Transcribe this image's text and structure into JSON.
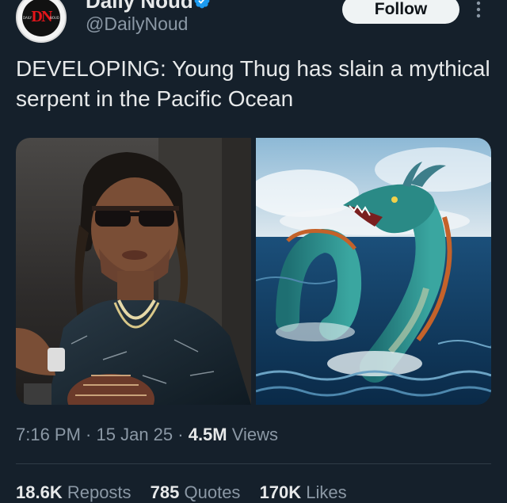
{
  "author": {
    "display_name": "Daily Noud",
    "handle": "@DailyNoud",
    "avatar_letters": "DN",
    "avatar_left_text": "DAILY",
    "avatar_right_text": "NOUD",
    "verified_icon": "verified-badge-icon"
  },
  "follow_label": "Follow",
  "more_icon": "more-vertical-icon",
  "tweet_text": "DEVELOPING: Young Thug has slain a mythical serpent in the Pacific Ocean",
  "media": [
    {
      "icon": "photo-person-sunglasses"
    },
    {
      "icon": "photo-sea-serpent"
    }
  ],
  "meta": {
    "time": "7:16 PM",
    "sep1": " · ",
    "date": "15 Jan 25",
    "sep2": " · ",
    "views_count": "4.5M",
    "views_label": " Views"
  },
  "stats": {
    "reposts_count": "18.6K",
    "reposts_label": " Reposts",
    "quotes_count": "785",
    "quotes_label": " Quotes",
    "likes_count": "170K",
    "likes_label": " Likes"
  },
  "colors": {
    "background": "#15202b",
    "text": "#e7e9ea",
    "muted": "#8b98a5",
    "verified": "#1d9bf0",
    "avatar_red": "#e3151a"
  }
}
